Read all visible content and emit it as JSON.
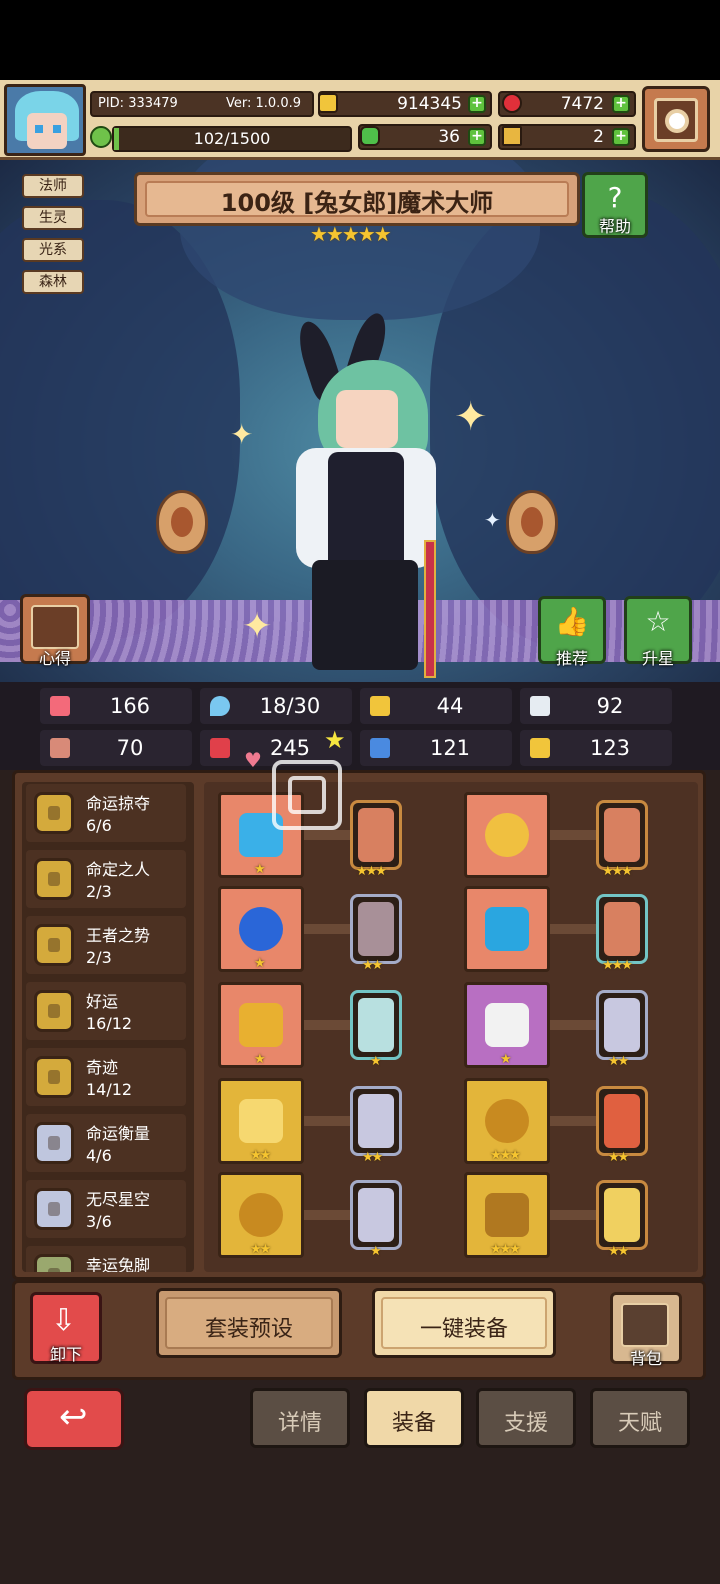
{
  "player": {
    "pid": "PID: 333479",
    "version": "Ver: 1.0.0.9",
    "stamina": "102/1500",
    "gold": "914345",
    "gems": "7472",
    "clovers": "36",
    "keys": "2"
  },
  "hero": {
    "title": "100级 [兔女郎]魔术大师",
    "stars": "★★★★★",
    "tags": [
      "法师",
      "生灵",
      "光系",
      "森林"
    ]
  },
  "scene_buttons": {
    "help": "帮助",
    "insight": "心得",
    "recommend": "推荐",
    "star_up": "升星"
  },
  "stats": {
    "hp": "166",
    "mana": "18/30",
    "defense": "44",
    "speed": "92",
    "attack": "70",
    "magic": "245",
    "crit": "121",
    "luck": "123"
  },
  "sets": [
    {
      "name": "命运掠夺",
      "count": "6/6",
      "tier": "gold"
    },
    {
      "name": "命定之人",
      "count": "2/3",
      "tier": "gold"
    },
    {
      "name": "王者之势",
      "count": "2/3",
      "tier": "gold"
    },
    {
      "name": "好运",
      "count": "16/12",
      "tier": "gold"
    },
    {
      "name": "奇迹",
      "count": "14/12",
      "tier": "gold"
    },
    {
      "name": "命运衡量",
      "count": "4/6",
      "tier": "silver"
    },
    {
      "name": "无尽星空",
      "count": "3/6",
      "tier": "silver"
    },
    {
      "name": "幸运兔脚",
      "count": "",
      "tier": "olive"
    }
  ],
  "equipment": [
    {
      "slot": "staff",
      "slot_stars": "★",
      "card_stars": "★★★",
      "left": true
    },
    {
      "slot": "hat",
      "slot_stars": "",
      "card_stars": "★★★",
      "left": false
    },
    {
      "slot": "orb",
      "slot_stars": "★",
      "card_stars": "★★",
      "left": true
    },
    {
      "slot": "armor",
      "slot_stars": "",
      "card_stars": "★★★",
      "left": false
    },
    {
      "slot": "necklace",
      "slot_stars": "★",
      "card_stars": "★",
      "left": true
    },
    {
      "slot": "glove",
      "slot_stars": "★",
      "card_stars": "★★",
      "left": false
    },
    {
      "slot": "emblem",
      "slot_stars": "★★",
      "card_stars": "★★",
      "left": true
    },
    {
      "slot": "ring",
      "slot_stars": "★★★",
      "card_stars": "★★",
      "left": false
    },
    {
      "slot": "ring2",
      "slot_stars": "★★",
      "card_stars": "★",
      "left": true
    },
    {
      "slot": "boots",
      "slot_stars": "★★★",
      "card_stars": "★★",
      "left": false
    }
  ],
  "actions": {
    "unequip": "卸下",
    "preset": "套装预设",
    "auto_equip": "一键装备",
    "bag": "背包"
  },
  "tabs": [
    "详情",
    "装备",
    "支援",
    "天赋"
  ],
  "active_tab": "装备",
  "colors": {
    "gold_star": "#f6c530",
    "plus_green": "#5fc23d",
    "action_red": "#e24b4b"
  }
}
